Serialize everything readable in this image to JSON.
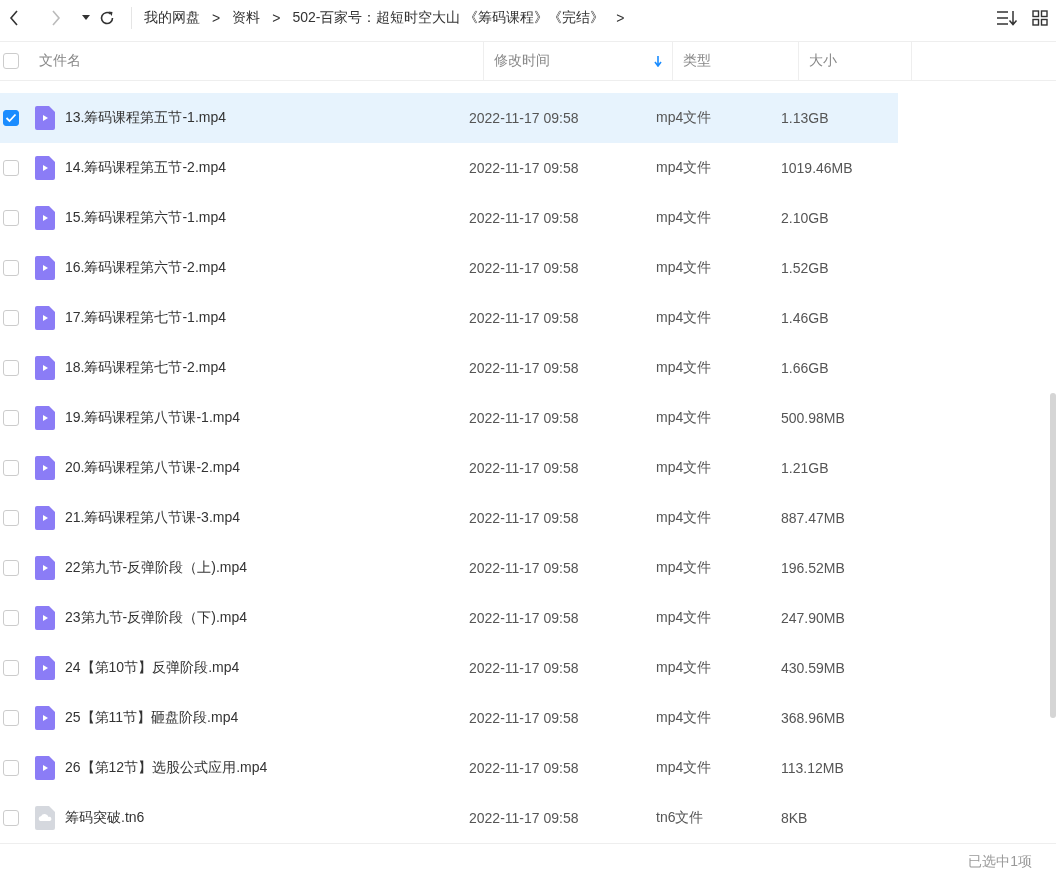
{
  "breadcrumb": {
    "items": [
      "我的网盘",
      "资料",
      "502-百家号：超短时空大山 《筹码课程》《完结》"
    ],
    "separator": ">"
  },
  "select_all": {
    "checked": false
  },
  "columns": [
    {
      "label": "文件名",
      "sorted": false
    },
    {
      "label": "修改时间",
      "sorted": true
    },
    {
      "label": "类型",
      "sorted": false
    },
    {
      "label": "大小",
      "sorted": false
    }
  ],
  "rows": [
    {
      "name": "13.筹码课程第五节-1.mp4",
      "time": "2022-11-17 09:58",
      "type": "mp4文件",
      "size": "1.13GB",
      "kind": "video",
      "selected": true
    },
    {
      "name": "14.筹码课程第五节-2.mp4",
      "time": "2022-11-17 09:58",
      "type": "mp4文件",
      "size": "1019.46MB",
      "kind": "video",
      "selected": false
    },
    {
      "name": "15.筹码课程第六节-1.mp4",
      "time": "2022-11-17 09:58",
      "type": "mp4文件",
      "size": "2.10GB",
      "kind": "video",
      "selected": false
    },
    {
      "name": "16.筹码课程第六节-2.mp4",
      "time": "2022-11-17 09:58",
      "type": "mp4文件",
      "size": "1.52GB",
      "kind": "video",
      "selected": false
    },
    {
      "name": "17.筹码课程第七节-1.mp4",
      "time": "2022-11-17 09:58",
      "type": "mp4文件",
      "size": "1.46GB",
      "kind": "video",
      "selected": false
    },
    {
      "name": "18.筹码课程第七节-2.mp4",
      "time": "2022-11-17 09:58",
      "type": "mp4文件",
      "size": "1.66GB",
      "kind": "video",
      "selected": false
    },
    {
      "name": "19.筹码课程第八节课-1.mp4",
      "time": "2022-11-17 09:58",
      "type": "mp4文件",
      "size": "500.98MB",
      "kind": "video",
      "selected": false
    },
    {
      "name": "20.筹码课程第八节课-2.mp4",
      "time": "2022-11-17 09:58",
      "type": "mp4文件",
      "size": "1.21GB",
      "kind": "video",
      "selected": false
    },
    {
      "name": "21.筹码课程第八节课-3.mp4",
      "time": "2022-11-17 09:58",
      "type": "mp4文件",
      "size": "887.47MB",
      "kind": "video",
      "selected": false
    },
    {
      "name": "22第九节-反弹阶段（上).mp4",
      "time": "2022-11-17 09:58",
      "type": "mp4文件",
      "size": "196.52MB",
      "kind": "video",
      "selected": false
    },
    {
      "name": "23第九节-反弹阶段（下).mp4",
      "time": "2022-11-17 09:58",
      "type": "mp4文件",
      "size": "247.90MB",
      "kind": "video",
      "selected": false
    },
    {
      "name": "24【第10节】反弹阶段.mp4",
      "time": "2022-11-17 09:58",
      "type": "mp4文件",
      "size": "430.59MB",
      "kind": "video",
      "selected": false
    },
    {
      "name": "25【第11节】砸盘阶段.mp4",
      "time": "2022-11-17 09:58",
      "type": "mp4文件",
      "size": "368.96MB",
      "kind": "video",
      "selected": false
    },
    {
      "name": "26【第12节】选股公式应用.mp4",
      "time": "2022-11-17 09:58",
      "type": "mp4文件",
      "size": "113.12MB",
      "kind": "video",
      "selected": false
    },
    {
      "name": "筹码突破.tn6",
      "time": "2022-11-17 09:58",
      "type": "tn6文件",
      "size": "8KB",
      "kind": "file",
      "selected": false
    }
  ],
  "status": "已选中1项"
}
